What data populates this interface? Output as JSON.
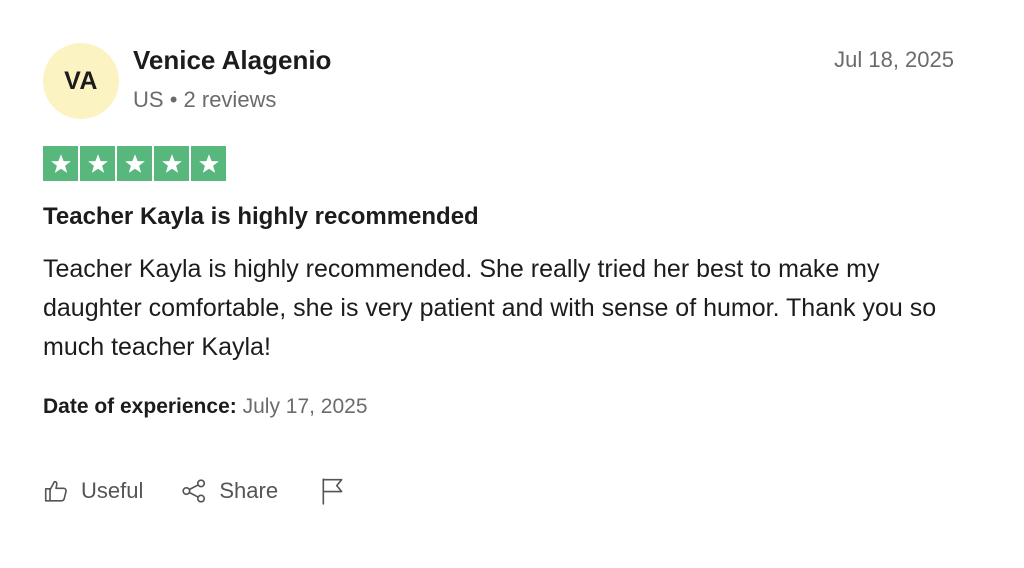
{
  "reviewer": {
    "initials": "VA",
    "name": "Venice Alagenio",
    "country": "US",
    "separator": "•",
    "reviews": "2 reviews",
    "avatar_color": "#fcf3c2"
  },
  "review": {
    "date": "Jul 18, 2025",
    "rating": 5,
    "rating_max": 5,
    "star_color": "#57b77c",
    "title": "Teacher Kayla is highly recommended",
    "body": "Teacher Kayla is highly recommended. She really tried her best to make my daughter comfortable, she is very patient and with sense of humor. Thank you so much teacher Kayla!",
    "experience_label": "Date of experience:",
    "experience_date": "July 17, 2025"
  },
  "actions": {
    "useful_label": "Useful",
    "useful_icon": "thumbs-up-icon",
    "share_label": "Share",
    "share_icon": "share-icon",
    "report_icon": "flag-icon"
  }
}
